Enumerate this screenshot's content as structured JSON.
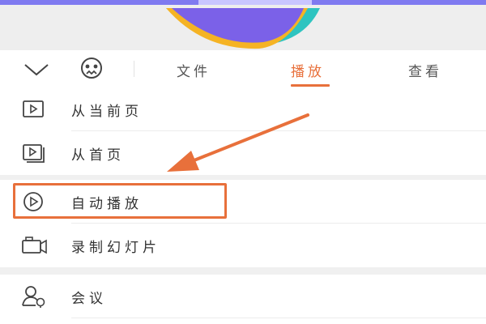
{
  "toolbar": {
    "tabs": [
      {
        "label": "文件",
        "active": false
      },
      {
        "label": "播放",
        "active": true
      },
      {
        "label": "查看",
        "active": false
      }
    ],
    "collapse_icon": "chevron-down-icon",
    "assistant_icon": "face-icon"
  },
  "menu": {
    "items": [
      {
        "label": "从当前页",
        "icon": "play-slide-icon"
      },
      {
        "label": "从首页",
        "icon": "play-slides-stack-icon"
      },
      {
        "label": "自动播放",
        "icon": "play-circle-icon",
        "highlighted": true
      },
      {
        "label": "录制幻灯片",
        "icon": "camera-icon"
      },
      {
        "label": "会议",
        "icon": "meeting-user-icon"
      }
    ]
  },
  "colors": {
    "accent": "#e8703b",
    "banner_purple": "#7b61e8",
    "banner_teal": "#2ec4c0",
    "banner_yellow": "#f5b324"
  }
}
